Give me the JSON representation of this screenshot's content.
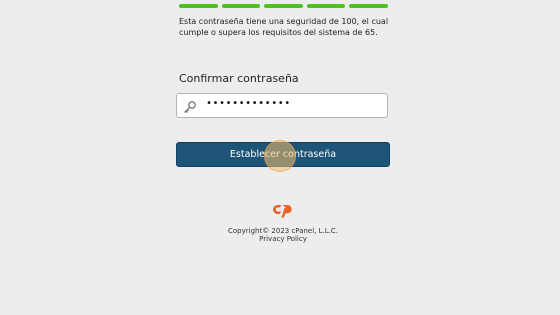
{
  "strength": {
    "segments": 5,
    "color": "#4bc21f",
    "message": "Esta contraseña tiene una seguridad de 100, el cual cumple o supera los requisitos del sistema de 65."
  },
  "confirm": {
    "label": "Confirmar contraseña",
    "value": "•••••••••••••",
    "icon": "key-icon"
  },
  "submit": {
    "label": "Establecer contraseña",
    "color": "#1d5477"
  },
  "footer": {
    "logo_icon": "cpanel-logo-icon",
    "copyright": "Copyright© 2023 cPanel, L.L.C.",
    "privacy": "Privacy Policy"
  }
}
